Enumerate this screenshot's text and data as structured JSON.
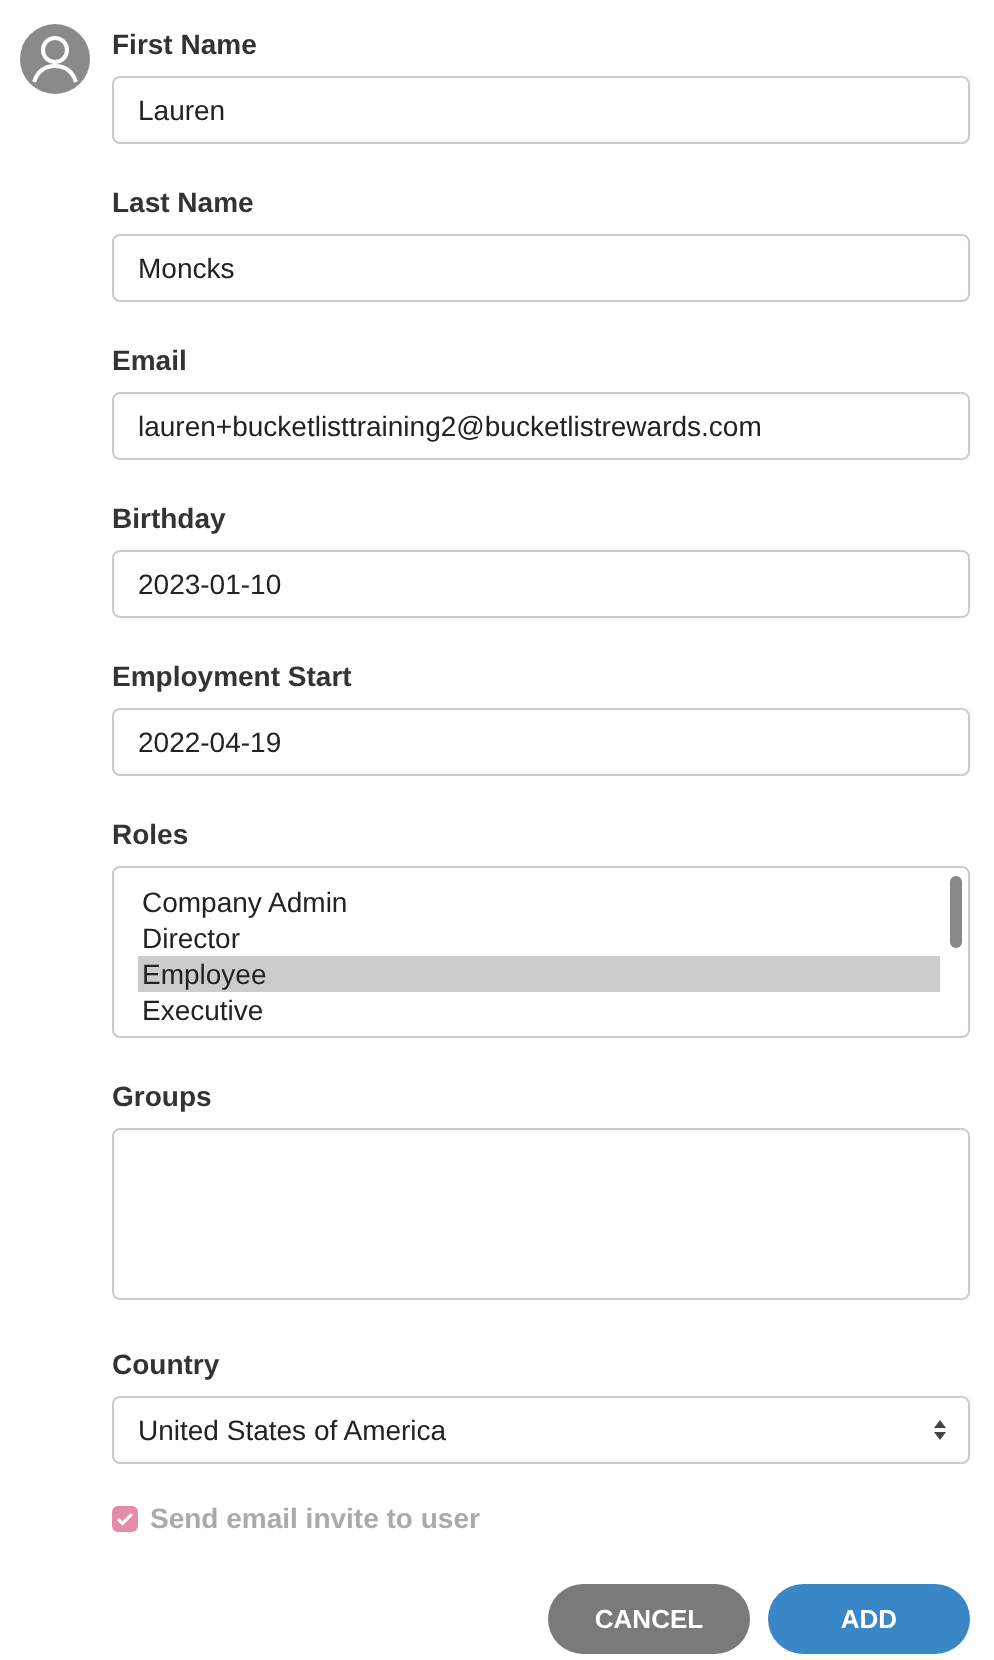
{
  "fields": [
    {
      "label": "First Name",
      "value": "Lauren"
    },
    {
      "label": "Last Name",
      "value": "Moncks"
    },
    {
      "label": "Email",
      "value": "lauren+bucketlisttraining2@bucketlistrewards.com"
    },
    {
      "label": "Birthday",
      "value": "2023-01-10"
    },
    {
      "label": "Employment Start",
      "value": "2022-04-19"
    }
  ],
  "roles": {
    "label": "Roles",
    "options": [
      {
        "label": "Company Admin",
        "selected": false
      },
      {
        "label": "Director",
        "selected": false
      },
      {
        "label": "Employee",
        "selected": true
      },
      {
        "label": "Executive",
        "selected": false
      }
    ]
  },
  "groups": {
    "label": "Groups"
  },
  "country": {
    "label": "Country",
    "value": "United States of America"
  },
  "invite": {
    "label": "Send email invite to user",
    "checked": true,
    "disabled": true
  },
  "buttons": [
    {
      "label": "CANCEL",
      "kind": "secondary"
    },
    {
      "label": "ADD",
      "kind": "primary"
    }
  ]
}
